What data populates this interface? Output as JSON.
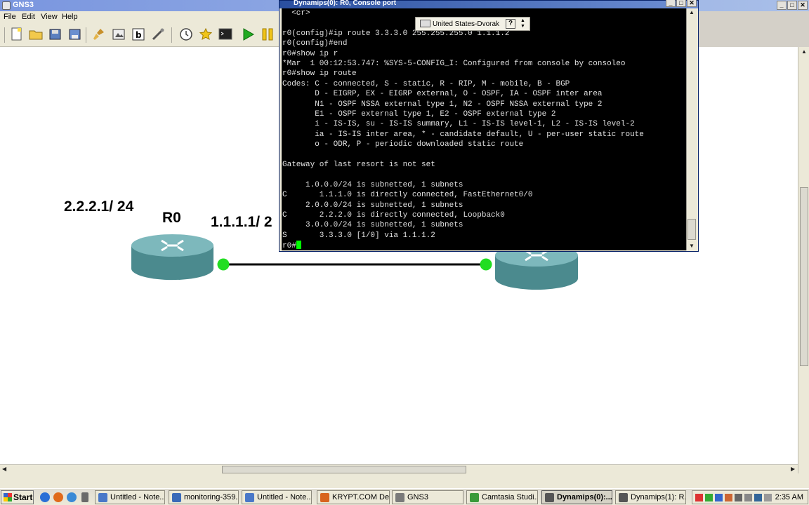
{
  "gns3": {
    "title": "GNS3",
    "menu": {
      "file": "File",
      "edit": "Edit",
      "view": "View",
      "help": "Help"
    }
  },
  "topology": {
    "r0_name": "R0",
    "loopback_label": "2.2.2.1/ 24",
    "link_label": "1.1.1.1/ 2",
    "status_color_up": "#22dd22"
  },
  "console": {
    "title": "Dynamips(0): R0, Console port",
    "language_bar": {
      "layout": "United States-Dvorak",
      "help": "?"
    },
    "lines": [
      "  <cr>",
      "",
      "r0(config)#ip route 3.3.3.0 255.255.255.0 1.1.1.2",
      "r0(config)#end",
      "r0#show ip r",
      "*Mar  1 00:12:53.747: %SYS-5-CONFIG_I: Configured from console by consoleo",
      "r0#show ip route",
      "Codes: C - connected, S - static, R - RIP, M - mobile, B - BGP",
      "       D - EIGRP, EX - EIGRP external, O - OSPF, IA - OSPF inter area",
      "       N1 - OSPF NSSA external type 1, N2 - OSPF NSSA external type 2",
      "       E1 - OSPF external type 1, E2 - OSPF external type 2",
      "       i - IS-IS, su - IS-IS summary, L1 - IS-IS level-1, L2 - IS-IS level-2",
      "       ia - IS-IS inter area, * - candidate default, U - per-user static route",
      "       o - ODR, P - periodic downloaded static route",
      "",
      "Gateway of last resort is not set",
      "",
      "     1.0.0.0/24 is subnetted, 1 subnets",
      "C       1.1.1.0 is directly connected, FastEthernet0/0",
      "     2.0.0.0/24 is subnetted, 1 subnets",
      "C       2.2.2.0 is directly connected, Loopback0",
      "     3.0.0.0/24 is subnetted, 1 subnets",
      "S       3.3.3.0 [1/0] via 1.1.1.2"
    ],
    "prompt": "r0#"
  },
  "taskbar": {
    "start": "Start",
    "tasks": [
      {
        "label": "Untitled - Note...",
        "icon_color": "#4a78c8",
        "active": false
      },
      {
        "label": "monitoring-359...",
        "icon_color": "#3a6ab8",
        "active": false
      },
      {
        "label": "Untitled - Note...",
        "icon_color": "#4a78c8",
        "active": false
      },
      {
        "label": "KRYPT.COM De...",
        "icon_color": "#d8641e",
        "active": false
      },
      {
        "label": "GNS3",
        "icon_color": "#7a7a7a",
        "active": false
      },
      {
        "label": "Camtasia Studi...",
        "icon_color": "#3a9a3a",
        "active": false
      },
      {
        "label": "Dynamips(0):...",
        "icon_color": "#555555",
        "active": true
      },
      {
        "label": "Dynamips(1): R...",
        "icon_color": "#555555",
        "active": false
      }
    ],
    "clock": "2:35 AM"
  }
}
